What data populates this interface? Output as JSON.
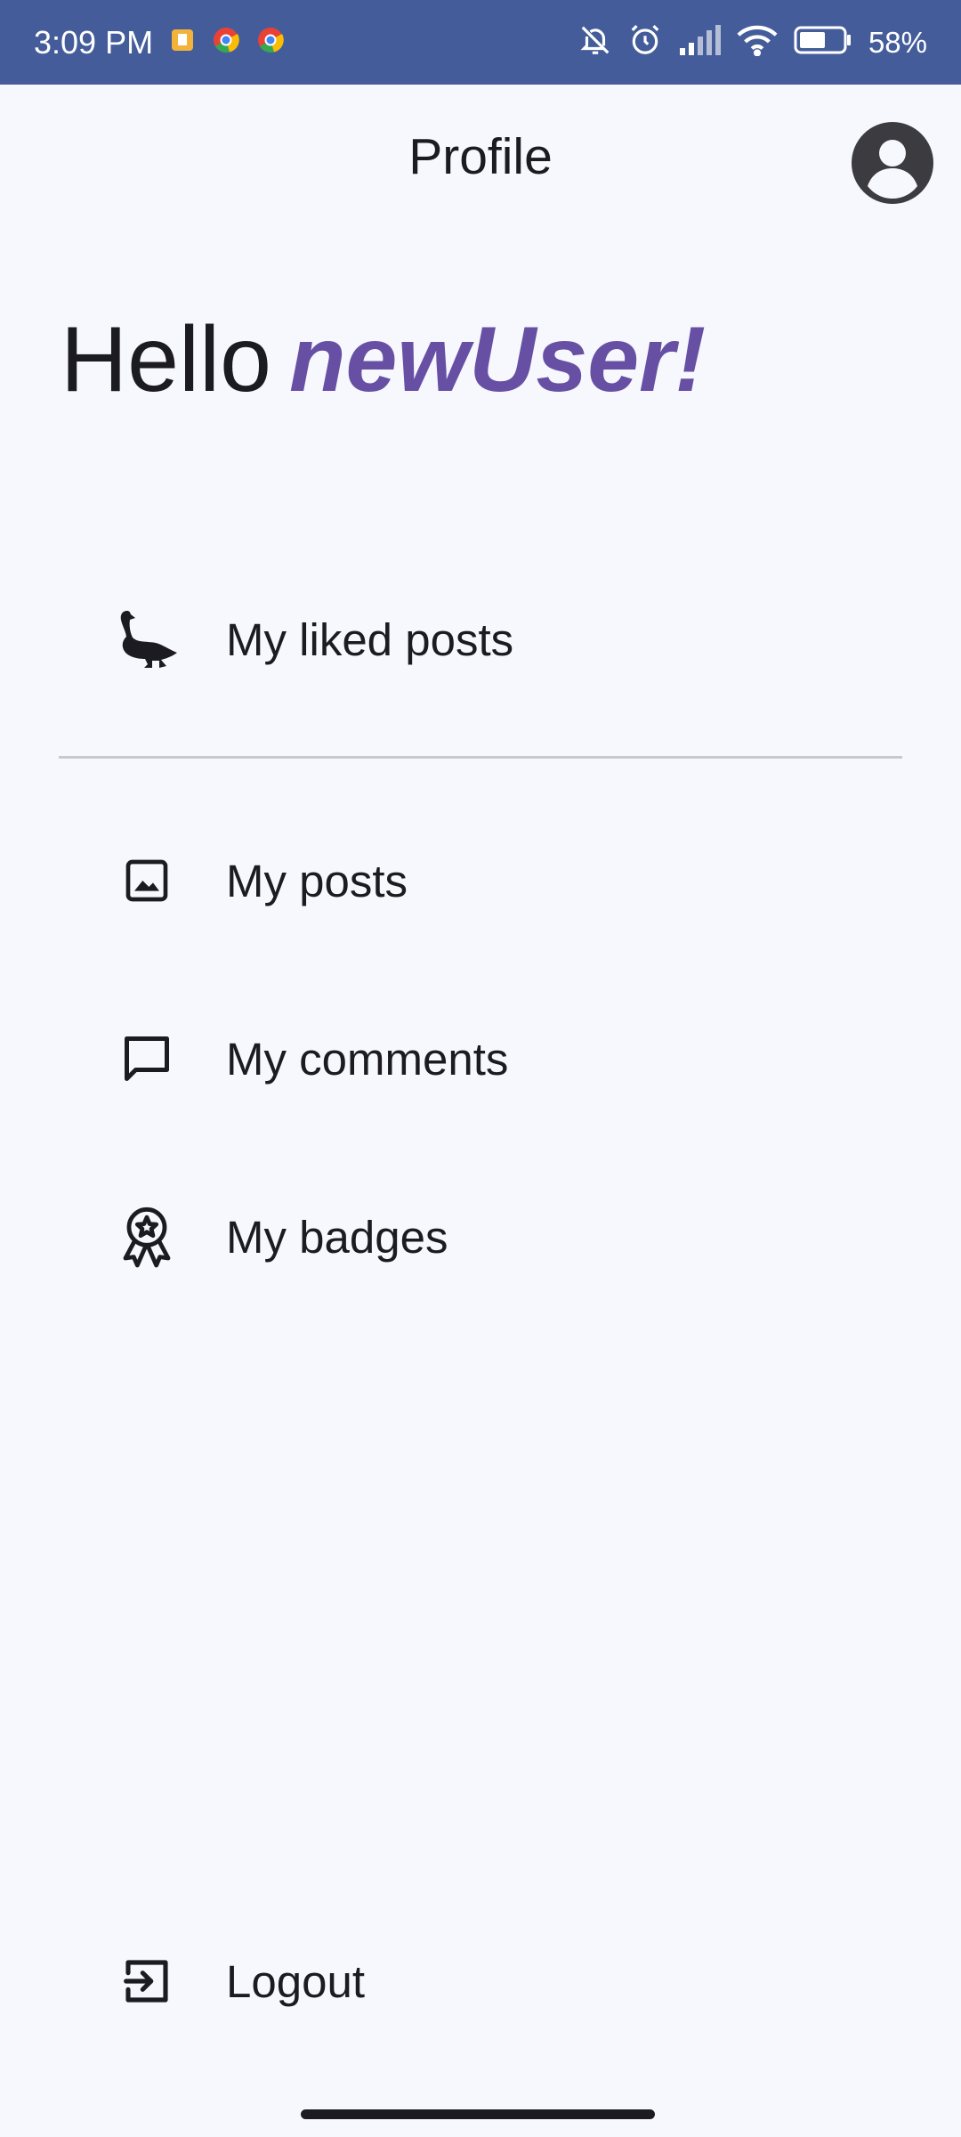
{
  "status_bar": {
    "time": "3:09 PM",
    "battery_percent": "58%",
    "icons_left": [
      "notification-icon",
      "chrome-icon",
      "chrome-icon"
    ],
    "icons_right": [
      "bell-off-icon",
      "alarm-icon",
      "signal-icon",
      "wifi-icon",
      "battery-icon"
    ]
  },
  "header": {
    "title": "Profile",
    "avatar_icon": "account-circle-icon"
  },
  "greeting": {
    "prefix": "Hello",
    "username": "newUser!"
  },
  "menu": {
    "liked_posts": {
      "label": "My liked posts",
      "icon": "goose-icon"
    },
    "posts": {
      "label": "My posts",
      "icon": "image-icon"
    },
    "comments": {
      "label": "My comments",
      "icon": "comment-icon"
    },
    "badges": {
      "label": "My badges",
      "icon": "badge-icon"
    },
    "logout": {
      "label": "Logout",
      "icon": "logout-icon"
    }
  },
  "colors": {
    "status_bar": "#445d9a",
    "accent": "#6750a4",
    "background": "#f7f8fd",
    "text": "#1c1b22"
  }
}
